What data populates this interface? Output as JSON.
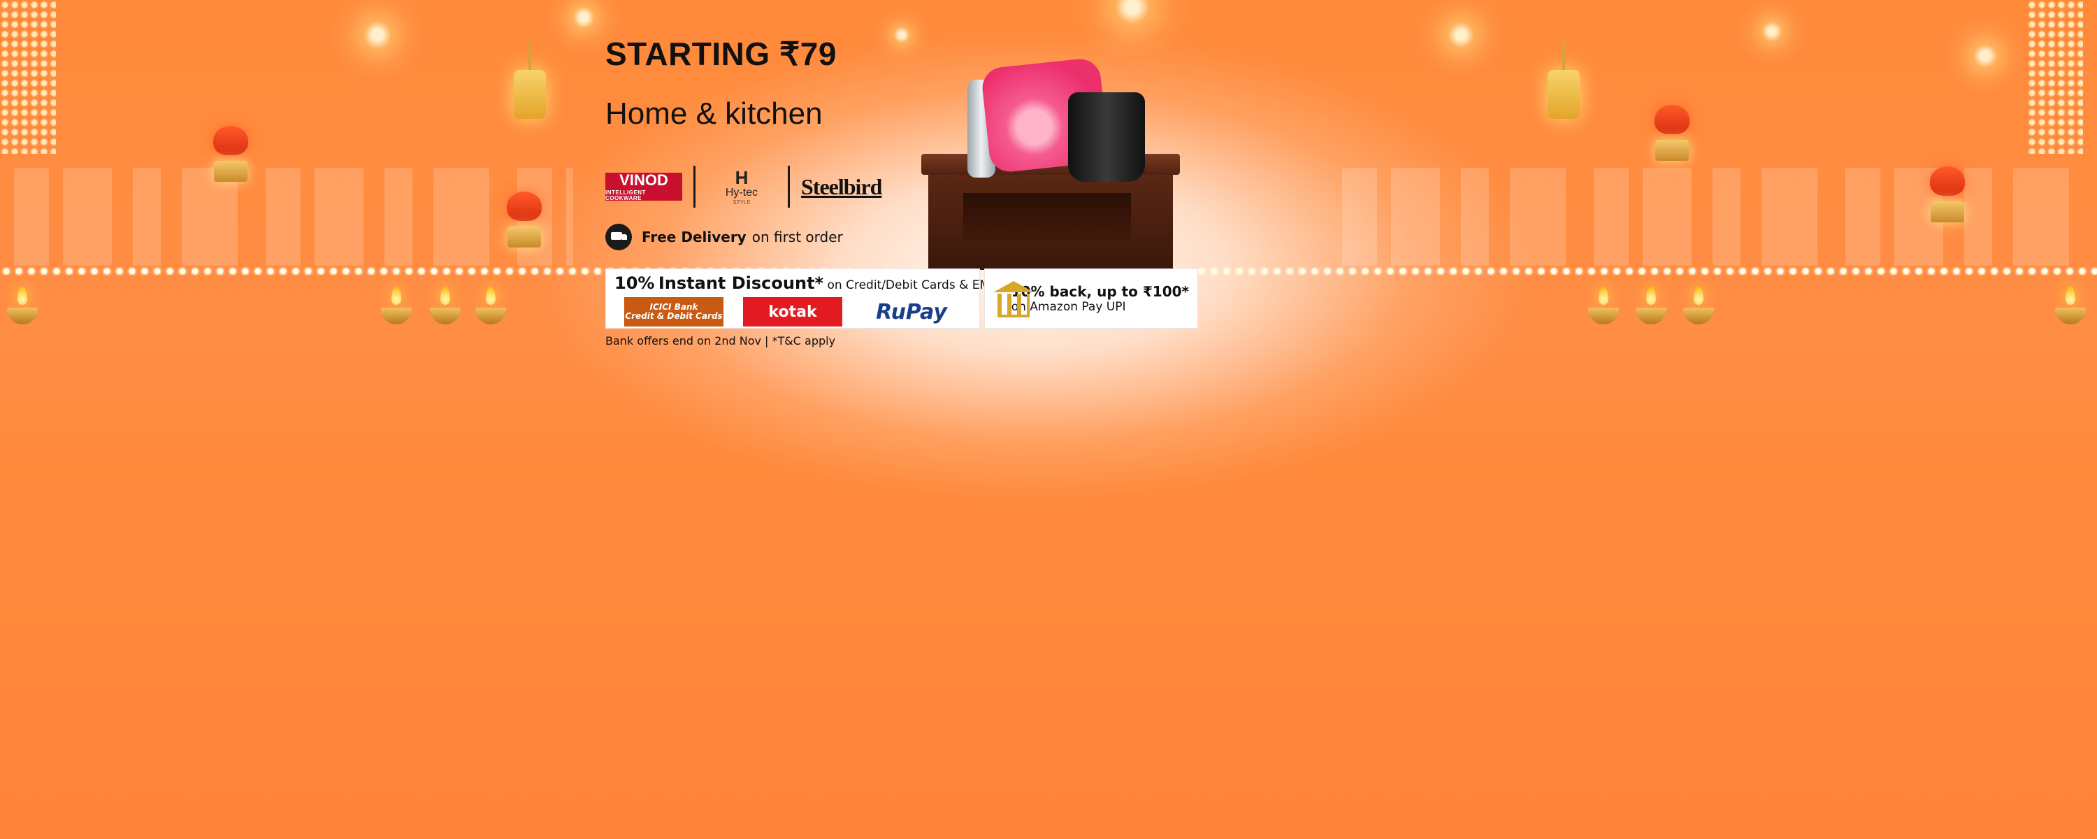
{
  "banner": {
    "headline": "STARTING ₹79",
    "category": "Home & kitchen",
    "brands": {
      "vinod": "VINOD",
      "vinod_tag": "INTELLIGENT COOKWARE",
      "hytec": "Hy-tec",
      "hytec_tag": "STYLE",
      "steelbird": "Steelbird"
    },
    "delivery": {
      "bold": "Free Delivery",
      "rest": "on first order"
    },
    "offer_bank": {
      "pct": "10%",
      "title": "Instant Discount*",
      "rest": "on Credit/Debit Cards & EMI",
      "banks": {
        "icici_1": "ICICI Bank",
        "icici_2": "Credit & Debit Cards",
        "kotak": "kotak",
        "rupay": "RuPay"
      }
    },
    "offer_upi": {
      "line1": "10% back, up to ₹100*",
      "line2": "on Amazon Pay UPI"
    },
    "terms": "Bank offers end on 2nd Nov | *T&C apply"
  }
}
